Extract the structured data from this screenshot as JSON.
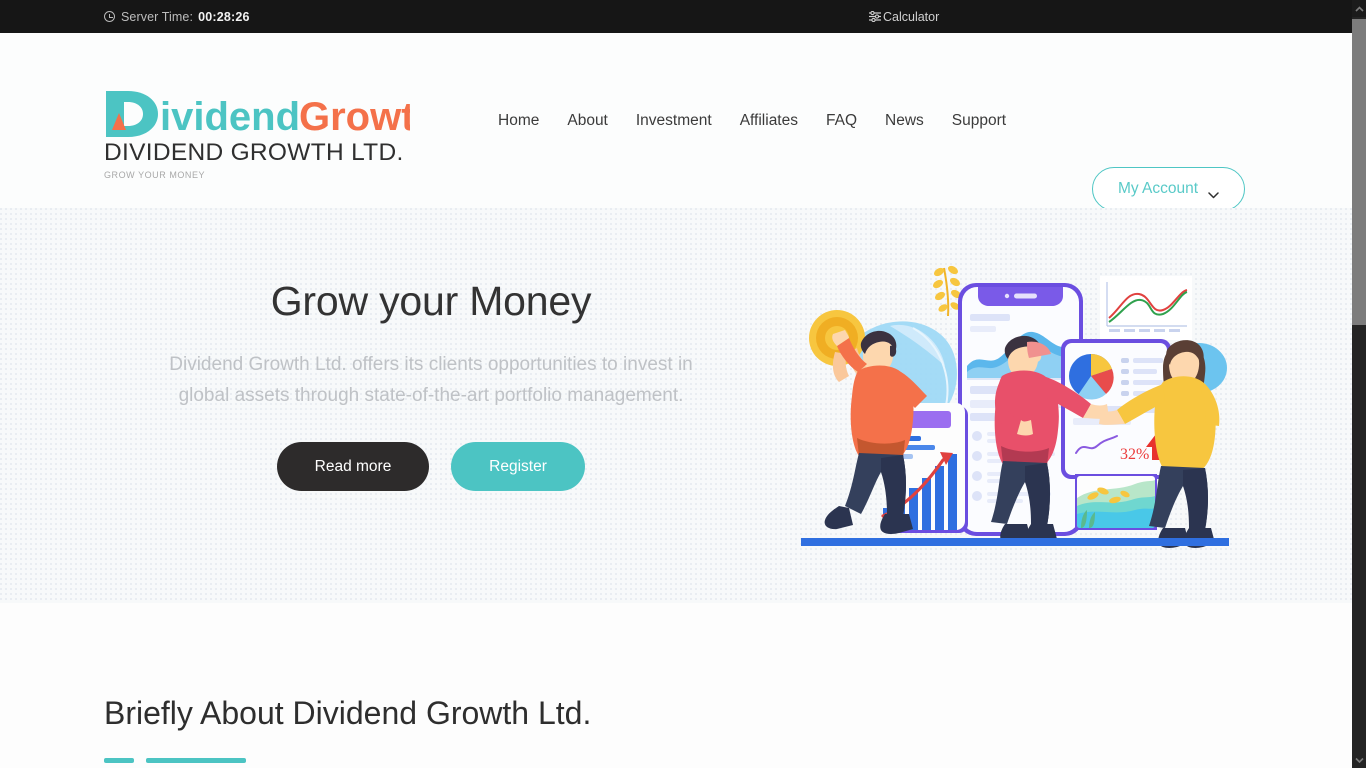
{
  "topbar": {
    "clock_icon": "clock-icon",
    "server_time_label": "Server Time:",
    "server_time_value": "00:28:26",
    "calculator_icon": "sliders-icon",
    "calculator_label": "Calculator"
  },
  "header": {
    "logo": {
      "word_one": "Dividend",
      "word_two": "Growth",
      "word_one_color": "#4cc4c3",
      "word_two_color": "#f4714a",
      "mark_icon": "logo-d-triangle-icon"
    },
    "company_name": "DIVIDEND GROWTH LTD.",
    "tagline": "GROW YOUR MONEY",
    "nav": [
      {
        "label": "Home"
      },
      {
        "label": "About"
      },
      {
        "label": "Investment"
      },
      {
        "label": "Affiliates"
      },
      {
        "label": "FAQ"
      },
      {
        "label": "News"
      },
      {
        "label": "Support"
      }
    ],
    "account_button": {
      "label": "My Account",
      "chevron_icon": "chevron-down-icon",
      "accent_color": "#4ec6c4"
    }
  },
  "hero": {
    "title": "Grow your Money",
    "subtitle": "Dividend Growth Ltd. offers its clients opportunities to invest in global assets through state-of-the-art portfolio management.",
    "primary_button": "Read more",
    "secondary_button": "Register",
    "illustration": {
      "name": "investment-team-illustration",
      "metric_label": "32%",
      "metric_color": "#ec3b3b"
    }
  },
  "about": {
    "title": "Briefly About Dividend Growth Ltd.",
    "accent_color": "#4cc4c3"
  },
  "scrollbar": {
    "up_icon": "chevron-up-icon",
    "down_icon": "chevron-down-icon",
    "thumb": "scroll-thumb"
  }
}
